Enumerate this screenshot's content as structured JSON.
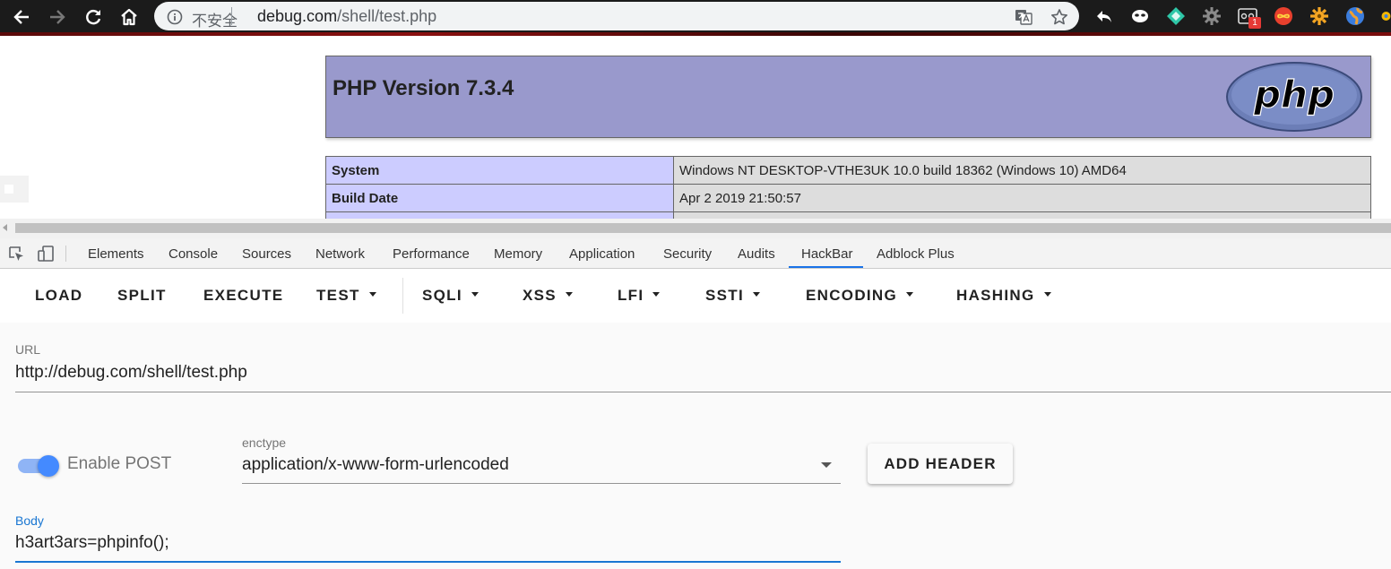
{
  "browser": {
    "insecure_label": "不安全",
    "url_host": "debug.com",
    "url_path": "/shell/test.php",
    "extension_badge": "1"
  },
  "page": {
    "php_title": "PHP Version 7.3.4",
    "php_logo_text": "php",
    "rows": [
      {
        "key": "System",
        "value": "Windows NT DESKTOP-VTHE3UK 10.0 build 18362 (Windows 10) AMD64"
      },
      {
        "key": "Build Date",
        "value": "Apr 2 2019 21:50:57"
      }
    ]
  },
  "devtools": {
    "tabs": [
      "Elements",
      "Console",
      "Sources",
      "Network",
      "Performance",
      "Memory",
      "Application",
      "Security",
      "Audits",
      "HackBar",
      "Adblock Plus"
    ],
    "active_tab": "HackBar"
  },
  "hackbar": {
    "menu": {
      "load": "LOAD",
      "split": "SPLIT",
      "execute": "EXECUTE",
      "test": "TEST",
      "sqli": "SQLI",
      "xss": "XSS",
      "lfi": "LFI",
      "ssti": "SSTI",
      "encoding": "ENCODING",
      "hashing": "HASHING"
    },
    "url_label": "URL",
    "url_value": "http://debug.com/shell/test.php",
    "enable_post_label": "Enable POST",
    "enable_post_on": true,
    "enctype_label": "enctype",
    "enctype_value": "application/x-www-form-urlencoded",
    "add_header_label": "ADD HEADER",
    "body_label": "Body",
    "body_value": "h3art3ars=phpinfo();"
  },
  "colors": {
    "accent": "#1a73e8",
    "php_header_bg": "#9999cc",
    "php_key_bg": "#ccccff",
    "php_value_bg": "#dddddd",
    "switch_on": "#448aff",
    "body_focus": "#1976d2"
  }
}
